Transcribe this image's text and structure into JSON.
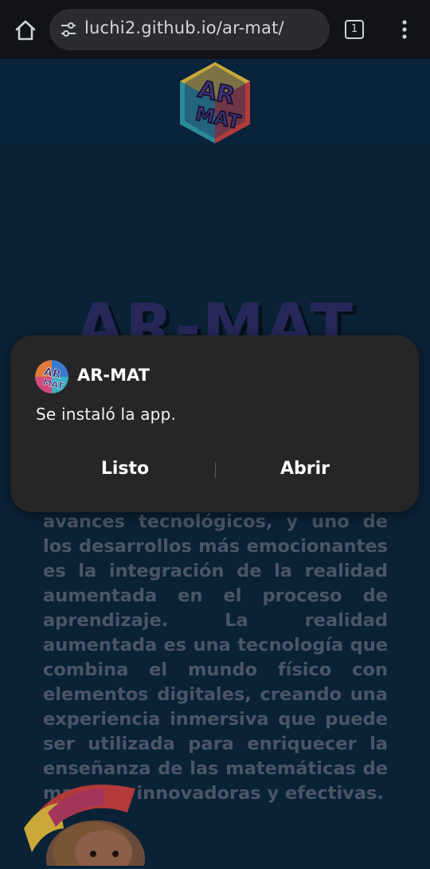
{
  "browser": {
    "url": "luchi2.github.io/ar-mat/",
    "tab_count": "1"
  },
  "page": {
    "hero_title": "AR-MAT",
    "paragraph": "avances tecnológicos, y uno de los desarrollos más emocionantes es la integración de la realidad aumentada en el proceso de aprendizaje. La realidad aumentada es una tecnología que combina el mundo físico con elementos digitales, creando una experiencia inmersiva que puede ser utilizada para enriquecer la enseñanza de las matemáticas de maneras innovadoras y efectivas.",
    "logo_text": "AR MAT"
  },
  "dialog": {
    "app_name": "AR-MAT",
    "message": "Se instaló la app.",
    "done_label": "Listo",
    "open_label": "Abrir"
  },
  "colors": {
    "page_bg": "#0a2236",
    "dialog_bg": "#262626",
    "topbar_bg": "#111316"
  }
}
